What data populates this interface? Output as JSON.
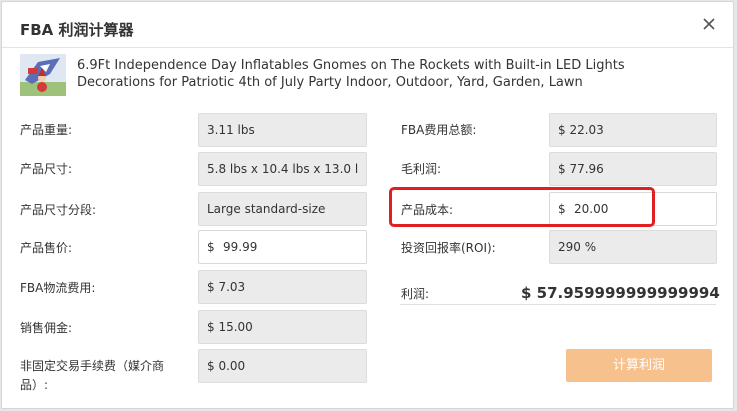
{
  "dialog": {
    "title": "FBA 利润计算器",
    "close_icon": "close-icon"
  },
  "product": {
    "title": "6.9Ft Independence Day Inflatables Gnomes on The Rockets with Built-in LED Lights Decorations for Patriotic 4th of July Party Indoor, Outdoor, Yard, Garden, Lawn",
    "thumbnail_icon": "product-thumbnail"
  },
  "left": [
    {
      "label": "产品重量:",
      "value": "3.11 lbs",
      "currency": ""
    },
    {
      "label": "产品尺寸:",
      "value": "5.8 lbs x 10.4 lbs x 13.0 l",
      "currency": ""
    },
    {
      "label": "产品尺寸分段:",
      "value": "Large standard-size",
      "currency": ""
    },
    {
      "label": "产品售价:",
      "value": "99.99",
      "currency": "$"
    },
    {
      "label": "FBA物流费用:",
      "value": "$ 7.03",
      "currency": ""
    },
    {
      "label": "销售佣金:",
      "value": "$ 15.00",
      "currency": ""
    },
    {
      "label": "非固定交易手续费（媒介商品）:",
      "value": "$ 0.00",
      "currency": ""
    }
  ],
  "right": [
    {
      "label": "FBA费用总额:",
      "value": "$ 22.03"
    },
    {
      "label": "毛利润:",
      "value": "$ 77.96"
    },
    {
      "label": "产品成本:",
      "value": "20.00",
      "currency": "$"
    },
    {
      "label": "投资回报率(ROI):",
      "value": "290 %"
    }
  ],
  "profit": {
    "label": "利润:",
    "value": "$ 57.959999999999994"
  },
  "buttons": {
    "calculate": "计算利润"
  },
  "colors": {
    "accent": "#f7c18e",
    "highlight": "#e02020",
    "readonly_bg": "#ebebeb"
  }
}
